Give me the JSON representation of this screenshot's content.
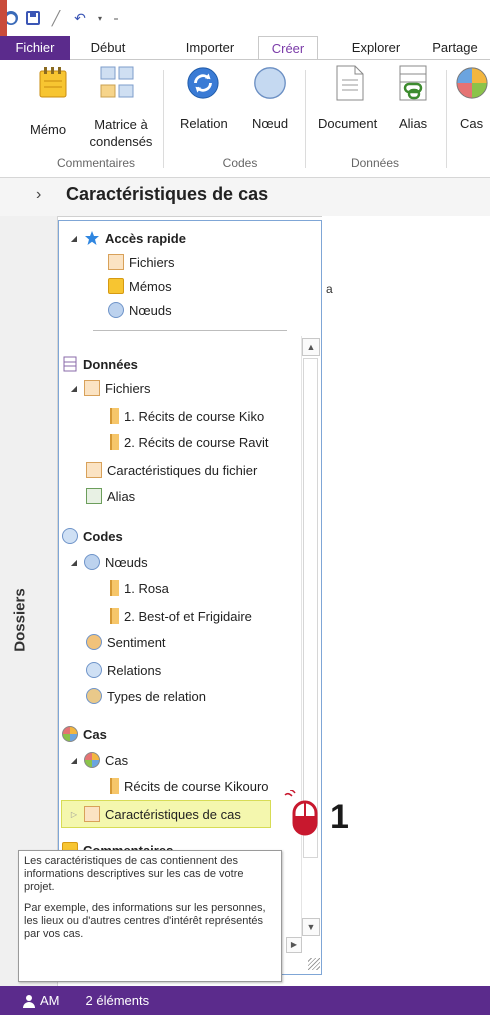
{
  "ribbon_tabs": [
    "Fichier",
    "Début",
    "Importer",
    "Créer",
    "Explorer",
    "Partage"
  ],
  "ribbon": {
    "buttons": [
      "Mémo",
      "Matrice à condensés",
      "Relation",
      "Nœud",
      "Document",
      "Alias",
      "Cas"
    ],
    "groups": [
      "Commentaires",
      "Codes",
      "Données"
    ]
  },
  "page": {
    "title": "Caractéristiques de cas",
    "bg_fragment": "a"
  },
  "panel": {
    "vertical_label": "Dossiers",
    "quick": {
      "header": "Accès rapide",
      "items": [
        "Fichiers",
        "Mémos",
        "Nœuds"
      ]
    },
    "data": {
      "header": "Données",
      "fichiers": "Fichiers",
      "files": [
        "1. Récits de course Kiko",
        "2. Récits de course Ravit"
      ],
      "file_chars": "Caractéristiques du fichier",
      "alias": "Alias"
    },
    "codes": {
      "header": "Codes",
      "nodes": "Nœuds",
      "node_items": [
        "1. Rosa",
        "2. Best-of et Frigidaire"
      ],
      "sentiment": "Sentiment",
      "relations": "Relations",
      "types": "Types de relation"
    },
    "cases": {
      "header": "Cas",
      "sub": "Cas",
      "item": "Récits de course Kikouro",
      "selected": "Caractéristiques de cas"
    },
    "comments": {
      "header": "Commentaires"
    }
  },
  "tooltip": {
    "p1": "Les caractéristiques de cas contiennent des informations descriptives sur les cas de votre projet.",
    "p2": "Par exemple, des informations sur les personnes, les lieux ou d'autres centres d'intérêt représentés par vos cas."
  },
  "callout": {
    "number": "1"
  },
  "status": {
    "initials": "AM",
    "count": "2 éléments"
  },
  "colors": {
    "accent": "#5b2b8c",
    "highlight": "#f4f7ae"
  }
}
